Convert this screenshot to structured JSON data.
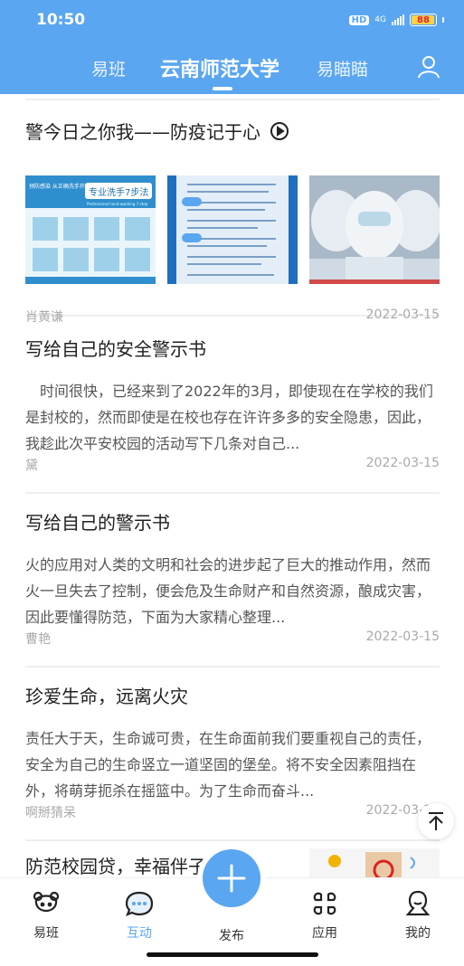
{
  "status_bar": {
    "time": "10:50",
    "hd": "HD",
    "network": "4G",
    "battery": "88"
  },
  "header": {
    "tabs": [
      {
        "label": "易班"
      },
      {
        "label": "云南师范大学"
      },
      {
        "label": "易瞄瞄"
      }
    ],
    "active_tab": "云南师范大学",
    "colors": {
      "primary": "#5aa6f0"
    }
  },
  "feed": {
    "posts": [
      {
        "title": "警今日之你我——防疫记于心",
        "has_video": true,
        "author": "肖黄谦",
        "date": "2022-03-15",
        "thumb_texts": [
          "专业洗手7步法",
          "Professional hand-washing 7-step",
          "预防感染 从正确洗手开始"
        ]
      },
      {
        "title": "写给自己的安全警示书",
        "excerpt": "　时间很快，已经来到了2022年的3月，即使现在在学校的我们是封校的，然而即使是在校也存在许许多多的安全隐患，因此，我趁此次平安校园的活动写下几条对自己...",
        "author": "黛",
        "date": "2022-03-15"
      },
      {
        "title": "写给自己的警示书",
        "excerpt": "火的应用对人类的文明和社会的进步起了巨大的推动作用，然而火一旦失去了控制，便会危及生命财产和自然资源，酿成灾害，因此要懂得防范，下面为大家精心整理...",
        "author": "曹艳",
        "date": "2022-03-15"
      },
      {
        "title": "珍爱生命，远离火灾",
        "excerpt": "责任大于天，生命诚可贵，在生命面前我们要重视自己的责任，安全为自己的生命竖立一道坚固的堡垒。将不安全因素阻挡在外，将萌芽扼杀在摇篮中。为了生命而奋斗...",
        "author": "啊掰猜呆",
        "date": "2022-03-15"
      },
      {
        "title": "防范校园贷，幸福伴子"
      }
    ]
  },
  "bottom_nav": {
    "items": [
      {
        "label": "易班"
      },
      {
        "label": "互动"
      },
      {
        "label": "发布"
      },
      {
        "label": "应用"
      },
      {
        "label": "我的"
      }
    ],
    "active": "互动"
  }
}
